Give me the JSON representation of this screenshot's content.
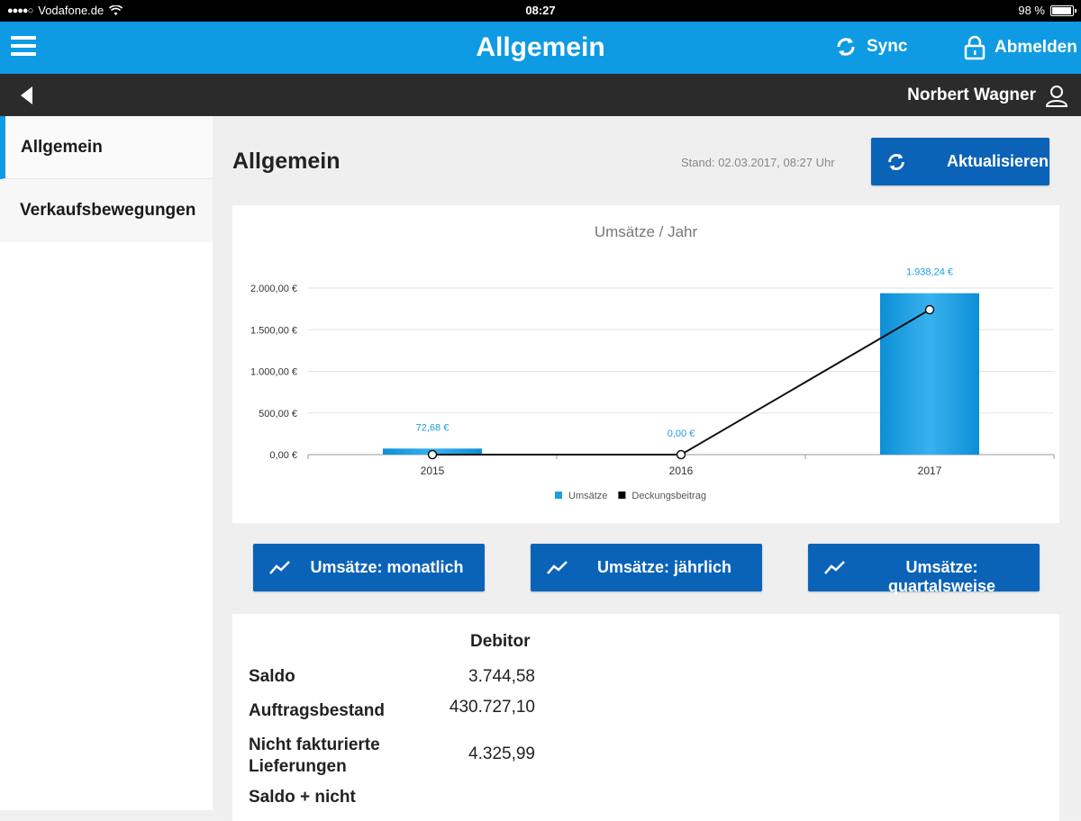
{
  "status_bar": {
    "carrier": "Vodafone.de",
    "time": "08:27",
    "battery_text": "98 %",
    "battery_level": 0.98
  },
  "header": {
    "title": "Allgemein",
    "sync_label": "Sync",
    "logout_label": "Abmelden",
    "color": "#0f9be3"
  },
  "subheader": {
    "user_name": "Norbert Wagner"
  },
  "sidebar": {
    "items": [
      {
        "label": "Allgemein",
        "active": true
      },
      {
        "label": "Verkaufsbewegungen",
        "active": false
      }
    ]
  },
  "main": {
    "title": "Allgemein",
    "stand": "Stand: 02.03.2017, 08:27 Uhr",
    "refresh_label": "Aktualisieren"
  },
  "chart_data": {
    "type": "bar",
    "title": "Umsätze / Jahr",
    "categories": [
      "2015",
      "2016",
      "2017"
    ],
    "series": [
      {
        "name": "Umsätze",
        "type": "bar",
        "values": [
          72.68,
          0.0,
          1938.24
        ],
        "labels": [
          "72,68 €",
          "0,00 €",
          "1.938,24 €"
        ],
        "color": "#1a9fe3"
      },
      {
        "name": "Deckungsbeitrag",
        "type": "line",
        "values": [
          0,
          0,
          1740
        ],
        "color": "#000000"
      }
    ],
    "y_ticks": [
      "0,00 €",
      "500,00 €",
      "1.000,00 €",
      "1.500,00 €",
      "2.000,00 €"
    ],
    "y_tick_values": [
      0,
      500,
      1000,
      1500,
      2000
    ],
    "ylim": [
      0,
      2000
    ],
    "grid": true,
    "legend": "bottom"
  },
  "buttons": [
    {
      "label": "Umsätze: monatlich"
    },
    {
      "label": "Umsätze: jährlich"
    },
    {
      "label": "Umsätze: quartalsweise"
    }
  ],
  "table": {
    "column_header": "Debitor",
    "rows": [
      {
        "label": "Saldo",
        "value": "3.744,58"
      },
      {
        "label": "Auftragsbestand",
        "value": "430.727,10"
      },
      {
        "label": "Nicht fakturierte Lieferungen",
        "value": "4.325,99"
      },
      {
        "label": "Saldo + nicht",
        "value": ""
      }
    ]
  }
}
